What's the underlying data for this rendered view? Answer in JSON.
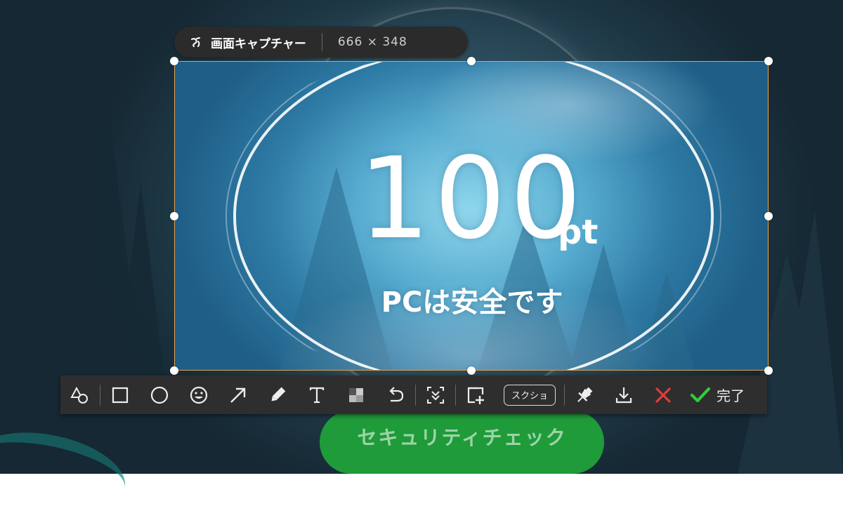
{
  "background": {
    "security_check_label": "セキュリティチェック"
  },
  "capture_title": {
    "label": "画面キャプチャー",
    "dimensions": "666 × 348"
  },
  "captured_content": {
    "score_value": "100",
    "score_unit": "pt",
    "status_text": "PCは安全です"
  },
  "toolbar": {
    "screenshot_label": "スクショ",
    "done_label": "完了",
    "tools": [
      "shapes-icon",
      "rectangle-icon",
      "ellipse-icon",
      "emoji-icon",
      "arrow-icon",
      "marker-icon",
      "text-icon",
      "mosaic-icon",
      "undo-icon",
      "scroll-capture-icon",
      "add-region-icon",
      "pin-icon",
      "download-icon",
      "cancel-icon",
      "confirm-check-icon"
    ]
  },
  "colors": {
    "selection_border": "#e8a04a",
    "cancel_red": "#e23b3b",
    "confirm_green": "#2ecc40",
    "security_button": "#1f9b3a"
  }
}
